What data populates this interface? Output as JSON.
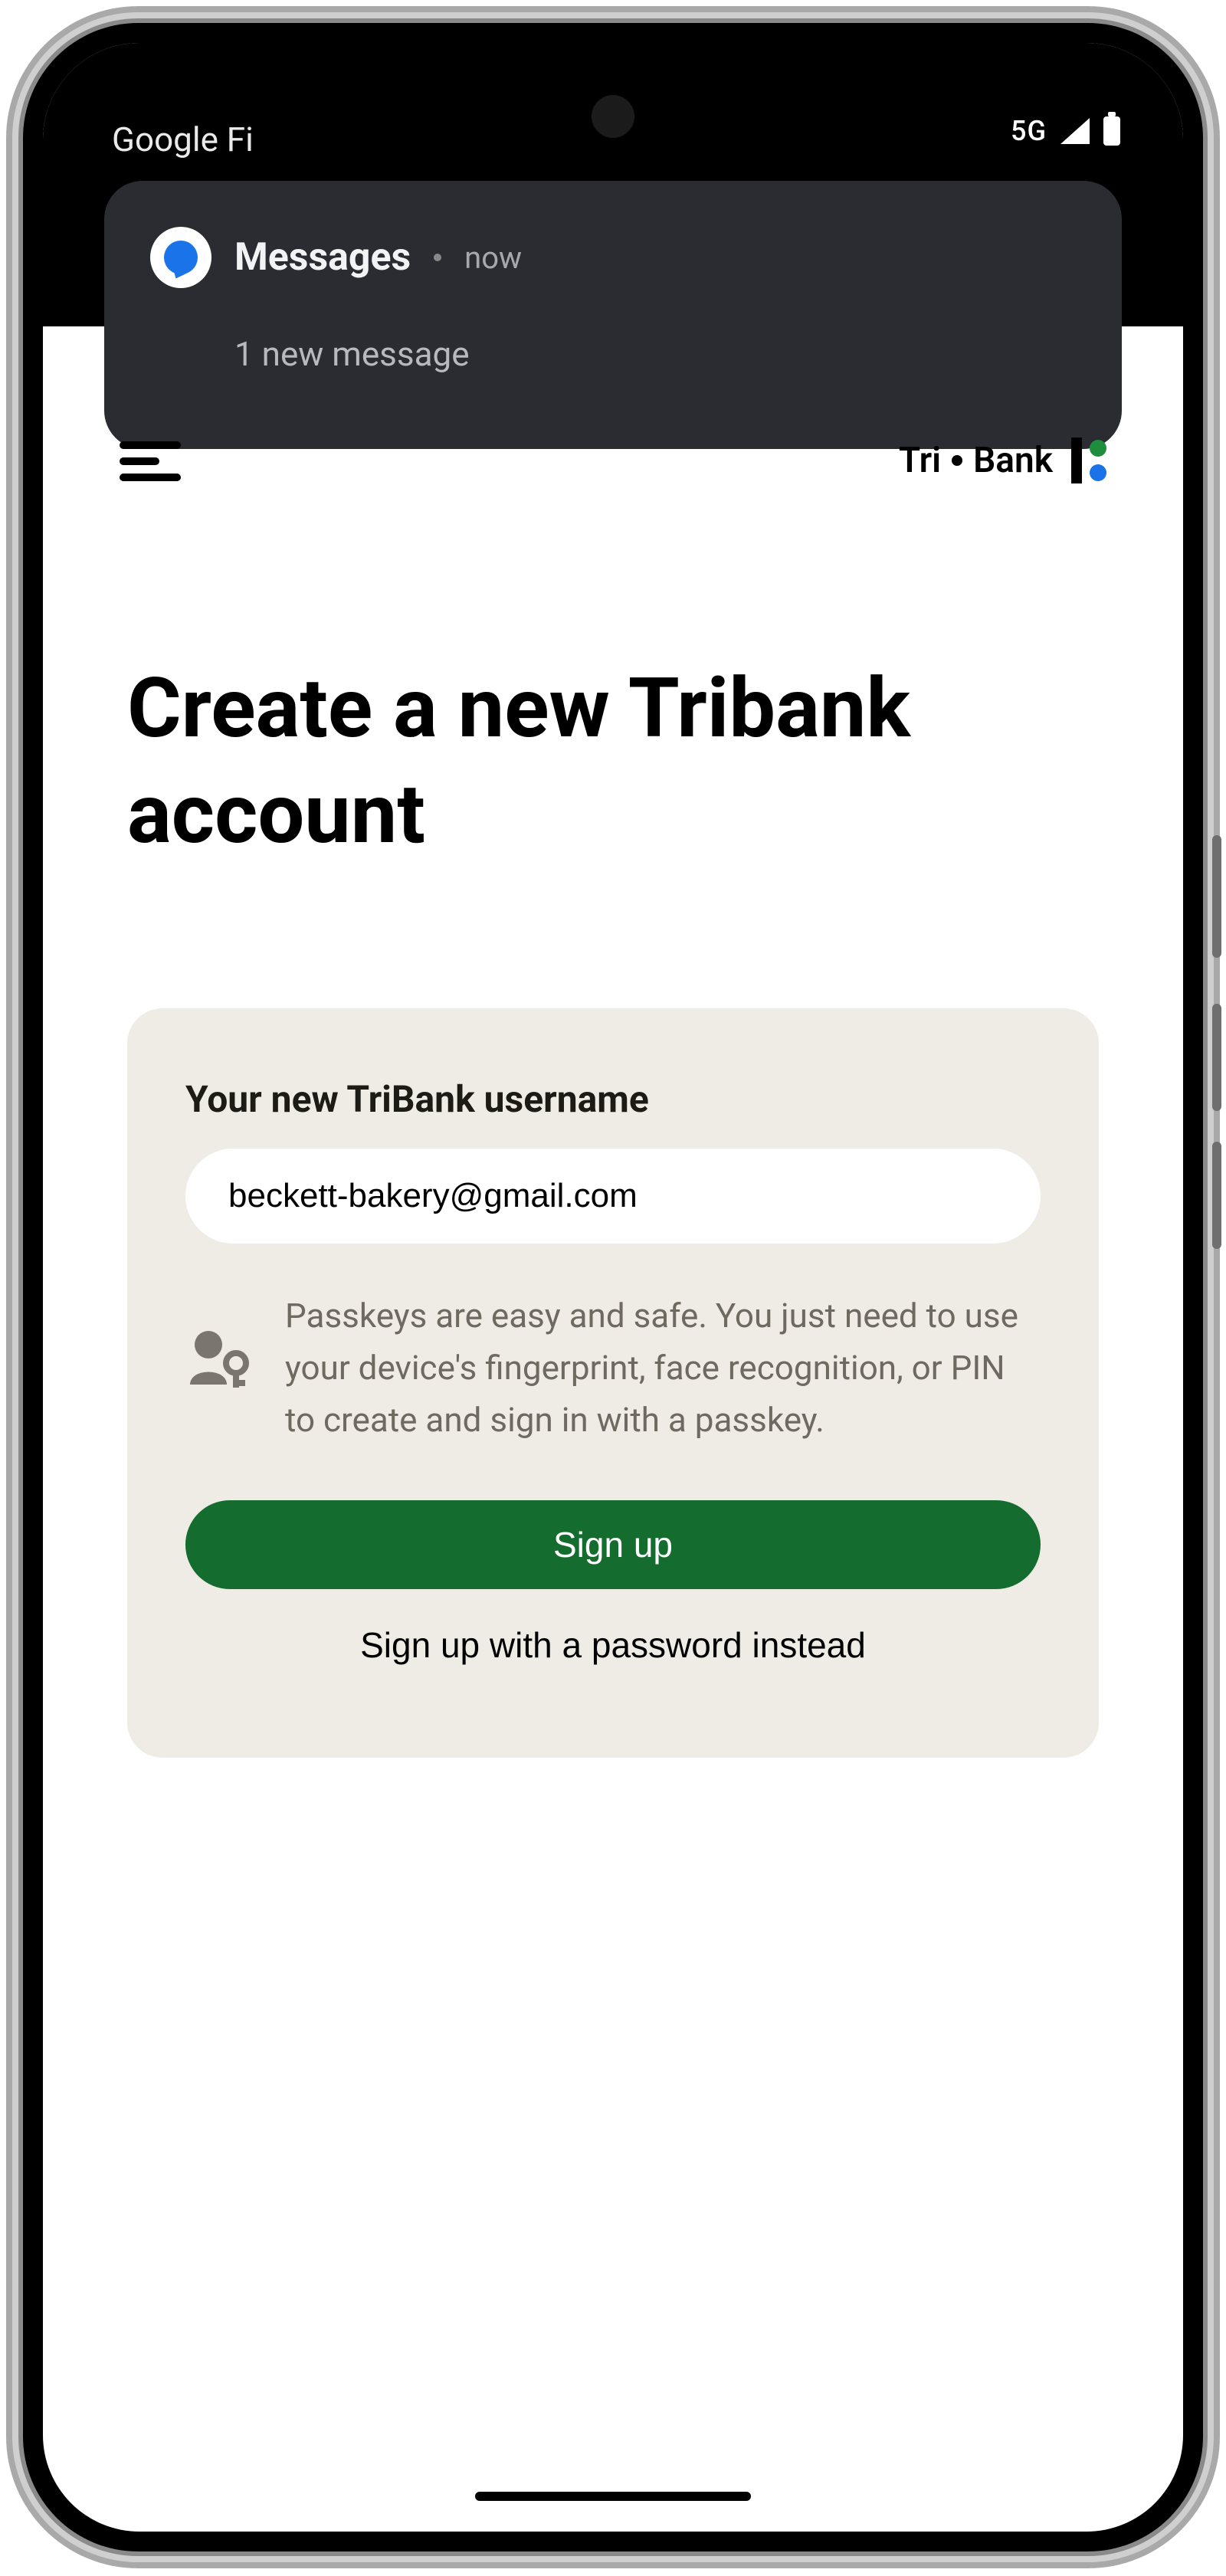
{
  "status_bar": {
    "carrier": "Google Fi",
    "network": "5G"
  },
  "notification": {
    "app": "Messages",
    "time": "now",
    "body": "1 new message"
  },
  "brand": {
    "part1": "Tri",
    "part2": "Bank"
  },
  "title": "Create a new Tribank account",
  "card": {
    "username_label": "Your new TriBank username",
    "username_value": "beckett-bakery@gmail.com",
    "passkey_info": "Passkeys are easy and safe. You just need to use your device's fingerprint, face recognition, or PIN to create and sign in with a passkey.",
    "signup_label": "Sign up",
    "alt_label": "Sign up with a password instead"
  }
}
